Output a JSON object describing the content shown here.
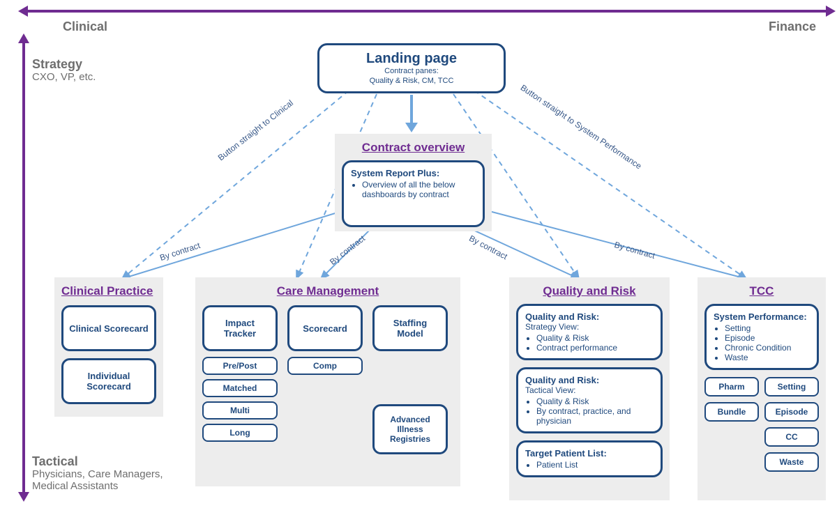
{
  "axes": {
    "left": "Clinical",
    "right": "Finance",
    "top": "Strategy",
    "top_sub": "CXO, VP, etc.",
    "bottom": "Tactical",
    "bottom_sub": "Physicians, Care Managers,\nMedical Assistants"
  },
  "landing": {
    "title": "Landing page",
    "line1": "Contract panes:",
    "line2": "Quality & Risk, CM, TCC"
  },
  "overview": {
    "heading": "Contract overview",
    "box_title": "System Report Plus:",
    "box_bullet": "Overview of all the below dashboards by contract"
  },
  "edge_labels": {
    "left_button": "Button straight to Clinical",
    "right_button": "Button straight to System Performance",
    "by_contract": "By contract"
  },
  "clinical": {
    "heading": "Clinical Practice",
    "items": [
      "Clinical Scorecard",
      "Individual Scorecard"
    ]
  },
  "care": {
    "heading": "Care Management",
    "impact": "Impact Tracker",
    "scorecard": "Scorecard",
    "staffing": "Staffing Model",
    "sub_impact": [
      "Pre/Post",
      "Matched",
      "Multi",
      "Long"
    ],
    "sub_score": [
      "Comp"
    ],
    "adv": "Advanced Illness Registries"
  },
  "quality": {
    "heading": "Quality and Risk",
    "box1_title": "Quality and Risk:",
    "box1_sub": "Strategy View:",
    "box1_bullets": [
      "Quality & Risk",
      "Contract performance"
    ],
    "box2_title": "Quality and Risk:",
    "box2_sub": "Tactical View:",
    "box2_bullets": [
      "Quality & Risk",
      "By contract, practice, and physician"
    ],
    "box3_title": "Target Patient List:",
    "box3_bullets": [
      "Patient List"
    ]
  },
  "tcc": {
    "heading": "TCC",
    "box_title": "System Performance:",
    "box_bullets": [
      "Setting",
      "Episode",
      "Chronic Condition",
      "Waste"
    ],
    "chips": [
      "Pharm",
      "Setting",
      "Bundle",
      "Episode",
      "CC",
      "Waste"
    ]
  }
}
